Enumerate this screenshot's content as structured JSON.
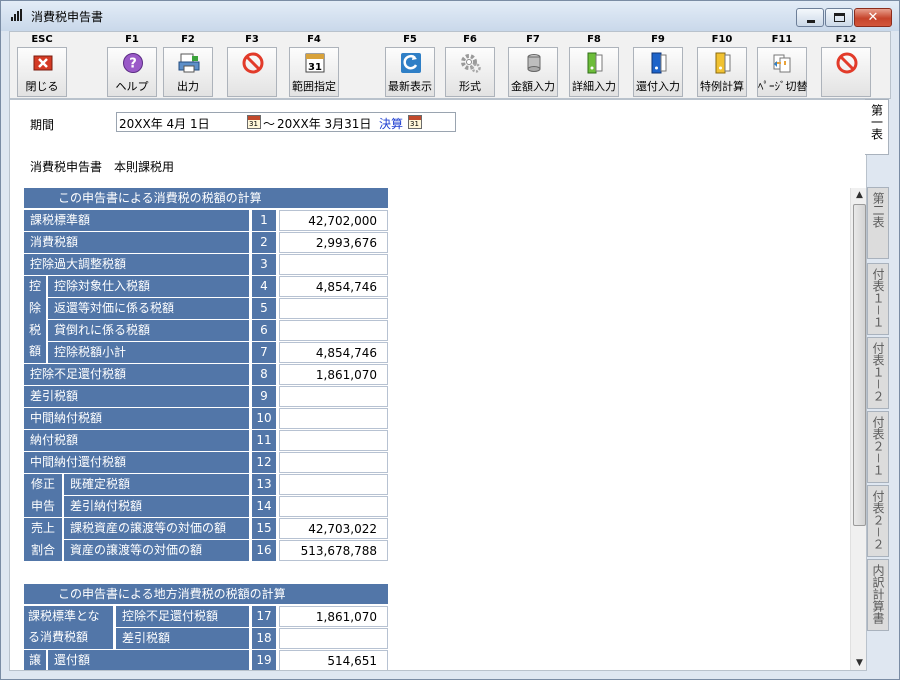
{
  "window": {
    "title": "消費税申告書"
  },
  "toolbar": [
    {
      "key": "ESC",
      "label": "閉じる",
      "icon": "close-red-icon"
    },
    {
      "key": "F1",
      "label": "ヘルプ",
      "icon": "help-icon"
    },
    {
      "key": "F2",
      "label": "出力",
      "icon": "print-icon"
    },
    {
      "key": "F3",
      "label": "",
      "icon": "no-entry-icon"
    },
    {
      "key": "F4",
      "label": "範囲指定",
      "icon": "calendar-icon"
    },
    {
      "key": "F5",
      "label": "最新表示",
      "icon": "refresh-icon"
    },
    {
      "key": "F6",
      "label": "形式",
      "icon": "gear-icon"
    },
    {
      "key": "F7",
      "label": "金額入力",
      "icon": "coins-icon"
    },
    {
      "key": "F8",
      "label": "詳細入力",
      "icon": "green-binder-icon"
    },
    {
      "key": "F9",
      "label": "還付入力",
      "icon": "blue-binder-icon"
    },
    {
      "key": "F10",
      "label": "特例計算",
      "icon": "yellow-binder-icon"
    },
    {
      "key": "F11",
      "label": "ﾍﾟｰｼﾞ切替",
      "icon": "page-switch-icon"
    },
    {
      "key": "F12",
      "label": "",
      "icon": "no-entry-icon"
    }
  ],
  "period": {
    "label": "期間",
    "from": "20XX年 4月 1日",
    "sep": "〜",
    "to": "20XX年 3月31日",
    "closing": "決算"
  },
  "subtitle": "消費税申告書　本則課税用",
  "section1": {
    "header": "この申告書による消費税の税額の計算",
    "rows": [
      {
        "label": "課税標準額",
        "no": "1",
        "value": "42,702,000"
      },
      {
        "label": "消費税額",
        "no": "2",
        "value": "2,993,676"
      },
      {
        "label": "控除過大調整税額",
        "no": "3",
        "value": ""
      },
      {
        "label": "控除対象仕入税額",
        "no": "4",
        "value": "4,854,746"
      },
      {
        "label": "返還等対価に係る税額",
        "no": "5",
        "value": ""
      },
      {
        "label": "貸倒れに係る税額",
        "no": "6",
        "value": ""
      },
      {
        "label": "控除税額小計",
        "no": "7",
        "value": "4,854,746"
      },
      {
        "label": "控除不足還付税額",
        "no": "8",
        "value": "1,861,070"
      },
      {
        "label": "差引税額",
        "no": "9",
        "value": ""
      },
      {
        "label": "中間納付税額",
        "no": "10",
        "value": ""
      },
      {
        "label": "納付税額",
        "no": "11",
        "value": ""
      },
      {
        "label": "中間納付還付税額",
        "no": "12",
        "value": ""
      },
      {
        "label": "既確定税額",
        "no": "13",
        "value": ""
      },
      {
        "label": "差引納付税額",
        "no": "14",
        "value": ""
      },
      {
        "label": "課税資産の譲渡等の対価の額",
        "no": "15",
        "value": "42,703,022"
      },
      {
        "label": "資産の譲渡等の対価の額",
        "no": "16",
        "value": "513,678,788"
      }
    ],
    "groups": {
      "deduction": [
        "控",
        "除",
        "税",
        "額"
      ],
      "amend": [
        "修正",
        "申告"
      ],
      "ratio": [
        "売上",
        "割合"
      ]
    }
  },
  "section2": {
    "header": "この申告書による地方消費税の税額の計算",
    "group_label": "課税標準とな\nる消費税額",
    "rows": [
      {
        "label": "控除不足還付税額",
        "no": "17",
        "value": "1,861,070"
      },
      {
        "label": "差引税額",
        "no": "18",
        "value": ""
      },
      {
        "label": "還付額",
        "no": "19",
        "value": "514,651"
      }
    ],
    "group2_label": "譲"
  },
  "side_tabs": [
    {
      "label": "第一表",
      "active": true
    },
    {
      "label": "第二表",
      "active": false
    },
    {
      "label": "付表１－１",
      "active": false
    },
    {
      "label": "付表１－２",
      "active": false
    },
    {
      "label": "付表２－１",
      "active": false
    },
    {
      "label": "付表２－２",
      "active": false
    },
    {
      "label": "内訳計算書",
      "active": false
    }
  ]
}
